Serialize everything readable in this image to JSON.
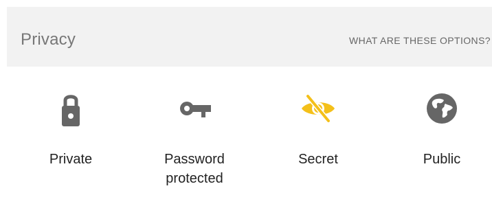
{
  "privacy": {
    "title": "Privacy",
    "help_link": "WHAT ARE THESE OPTIONS?"
  },
  "options": [
    {
      "label": "Private",
      "icon": "lock-icon",
      "selected": false,
      "color": "#666666"
    },
    {
      "label": "Password\nprotected",
      "icon": "key-icon",
      "selected": false,
      "color": "#666666"
    },
    {
      "label": "Secret",
      "icon": "eye-off-icon",
      "selected": true,
      "color": "#f4c01a"
    },
    {
      "label": "Public",
      "icon": "globe-icon",
      "selected": false,
      "color": "#666666"
    }
  ]
}
